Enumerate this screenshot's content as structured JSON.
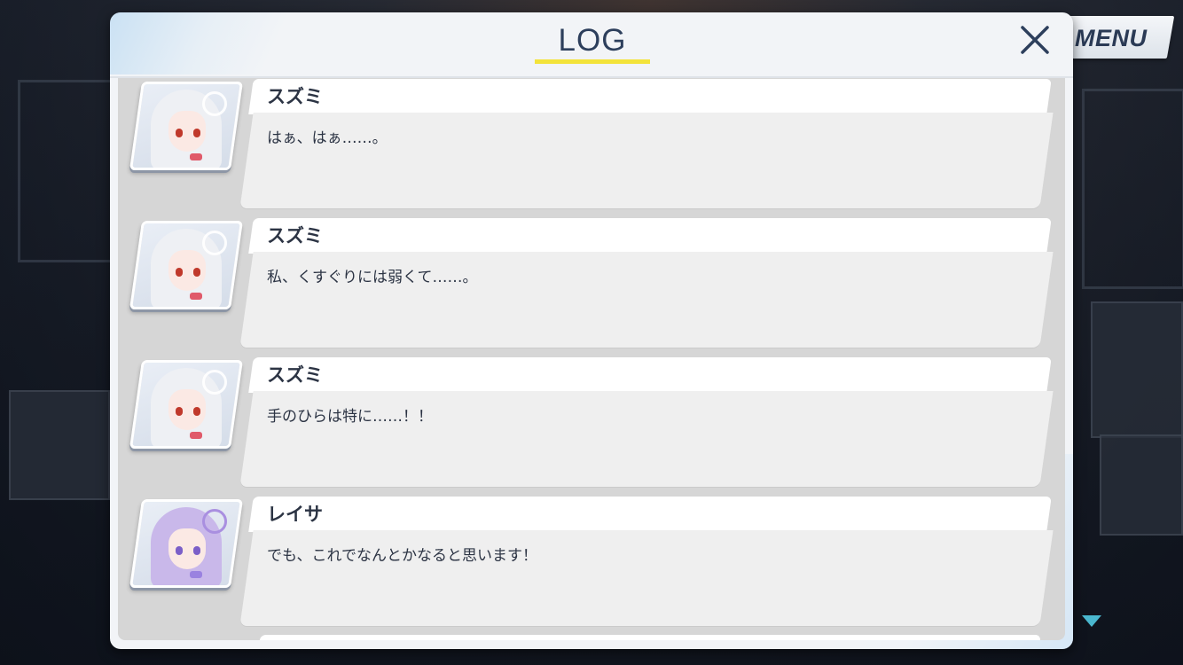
{
  "menu": {
    "label": "MENU"
  },
  "log": {
    "title": "LOG",
    "entries": [
      {
        "name": "スズミ",
        "text": "はぁ、はぁ……。",
        "portrait": "suzumi-portrait"
      },
      {
        "name": "スズミ",
        "text": "私、くすぐりには弱くて……。",
        "portrait": "suzumi-portrait"
      },
      {
        "name": "スズミ",
        "text": "手のひらは特に……！！",
        "portrait": "suzumi-portrait"
      },
      {
        "name": "レイサ",
        "text": "でも、これでなんとかなると思います！",
        "portrait": "reisa-portrait"
      }
    ]
  },
  "icons": {
    "close": "close-icon",
    "scroll_down": "triangle-down-icon"
  },
  "colors": {
    "title_text": "#2d3f5c",
    "title_underline": "#f3e33a",
    "scroll_arrow": "#4ab7cf",
    "suzumi_hair": "#eef0f4",
    "suzumi_eyes": "#c0392b",
    "reisa_hair": "#c9b8ea",
    "reisa_eyes": "#7b5fc8"
  }
}
